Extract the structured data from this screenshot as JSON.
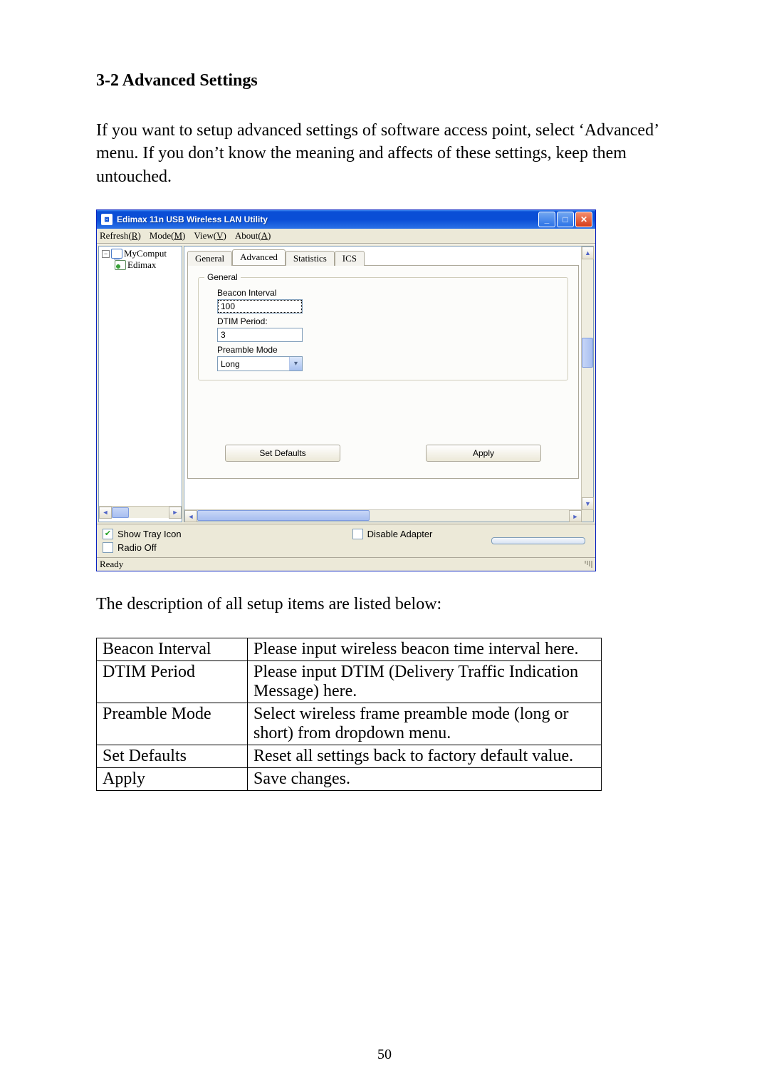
{
  "doc": {
    "section_heading": "3-2 Advanced Settings",
    "intro": "If you want to setup advanced settings of software access point, select ‘Advanced’ menu. If you don’t know the meaning and affects of these settings, keep them untouched.",
    "post_text": "The description of all setup items are listed below:",
    "page_number": "50"
  },
  "window": {
    "title": "Edimax 11n USB Wireless LAN Utility",
    "menus": {
      "refresh": "Refresh(R)",
      "mode": "Mode(M)",
      "view": "View(V)",
      "about": "About(A)",
      "refresh_u": "R",
      "mode_u": "M",
      "view_u": "V",
      "about_u": "A"
    },
    "tree": {
      "root": "MyComput",
      "child": "Edimax"
    },
    "tabs": {
      "general": "General",
      "advanced": "Advanced",
      "statistics": "Statistics",
      "ics": "ICS"
    },
    "group": {
      "legend": "General",
      "beacon_label": "Beacon Interval",
      "beacon_value": "100",
      "dtim_label": "DTIM Period:",
      "dtim_value": "3",
      "preamble_label": "Preamble Mode",
      "preamble_value": "Long"
    },
    "buttons": {
      "set_defaults": "Set Defaults",
      "apply": "Apply"
    },
    "checks": {
      "show_tray": "Show Tray Icon",
      "radio_off": "Radio Off",
      "disable_adapter": "Disable Adapter"
    },
    "status": "Ready"
  },
  "table": {
    "rows": [
      {
        "name": "Beacon Interval",
        "desc": "Please input wireless beacon time interval here."
      },
      {
        "name": "DTIM Period",
        "desc": "Please input DTIM (Delivery Traffic Indication Message) here."
      },
      {
        "name": "Preamble Mode",
        "desc": "Select wireless frame preamble mode (long or short) from dropdown menu."
      },
      {
        "name": "Set Defaults",
        "desc": "Reset all settings back to factory default value."
      },
      {
        "name": "Apply",
        "desc": "Save changes."
      }
    ]
  }
}
